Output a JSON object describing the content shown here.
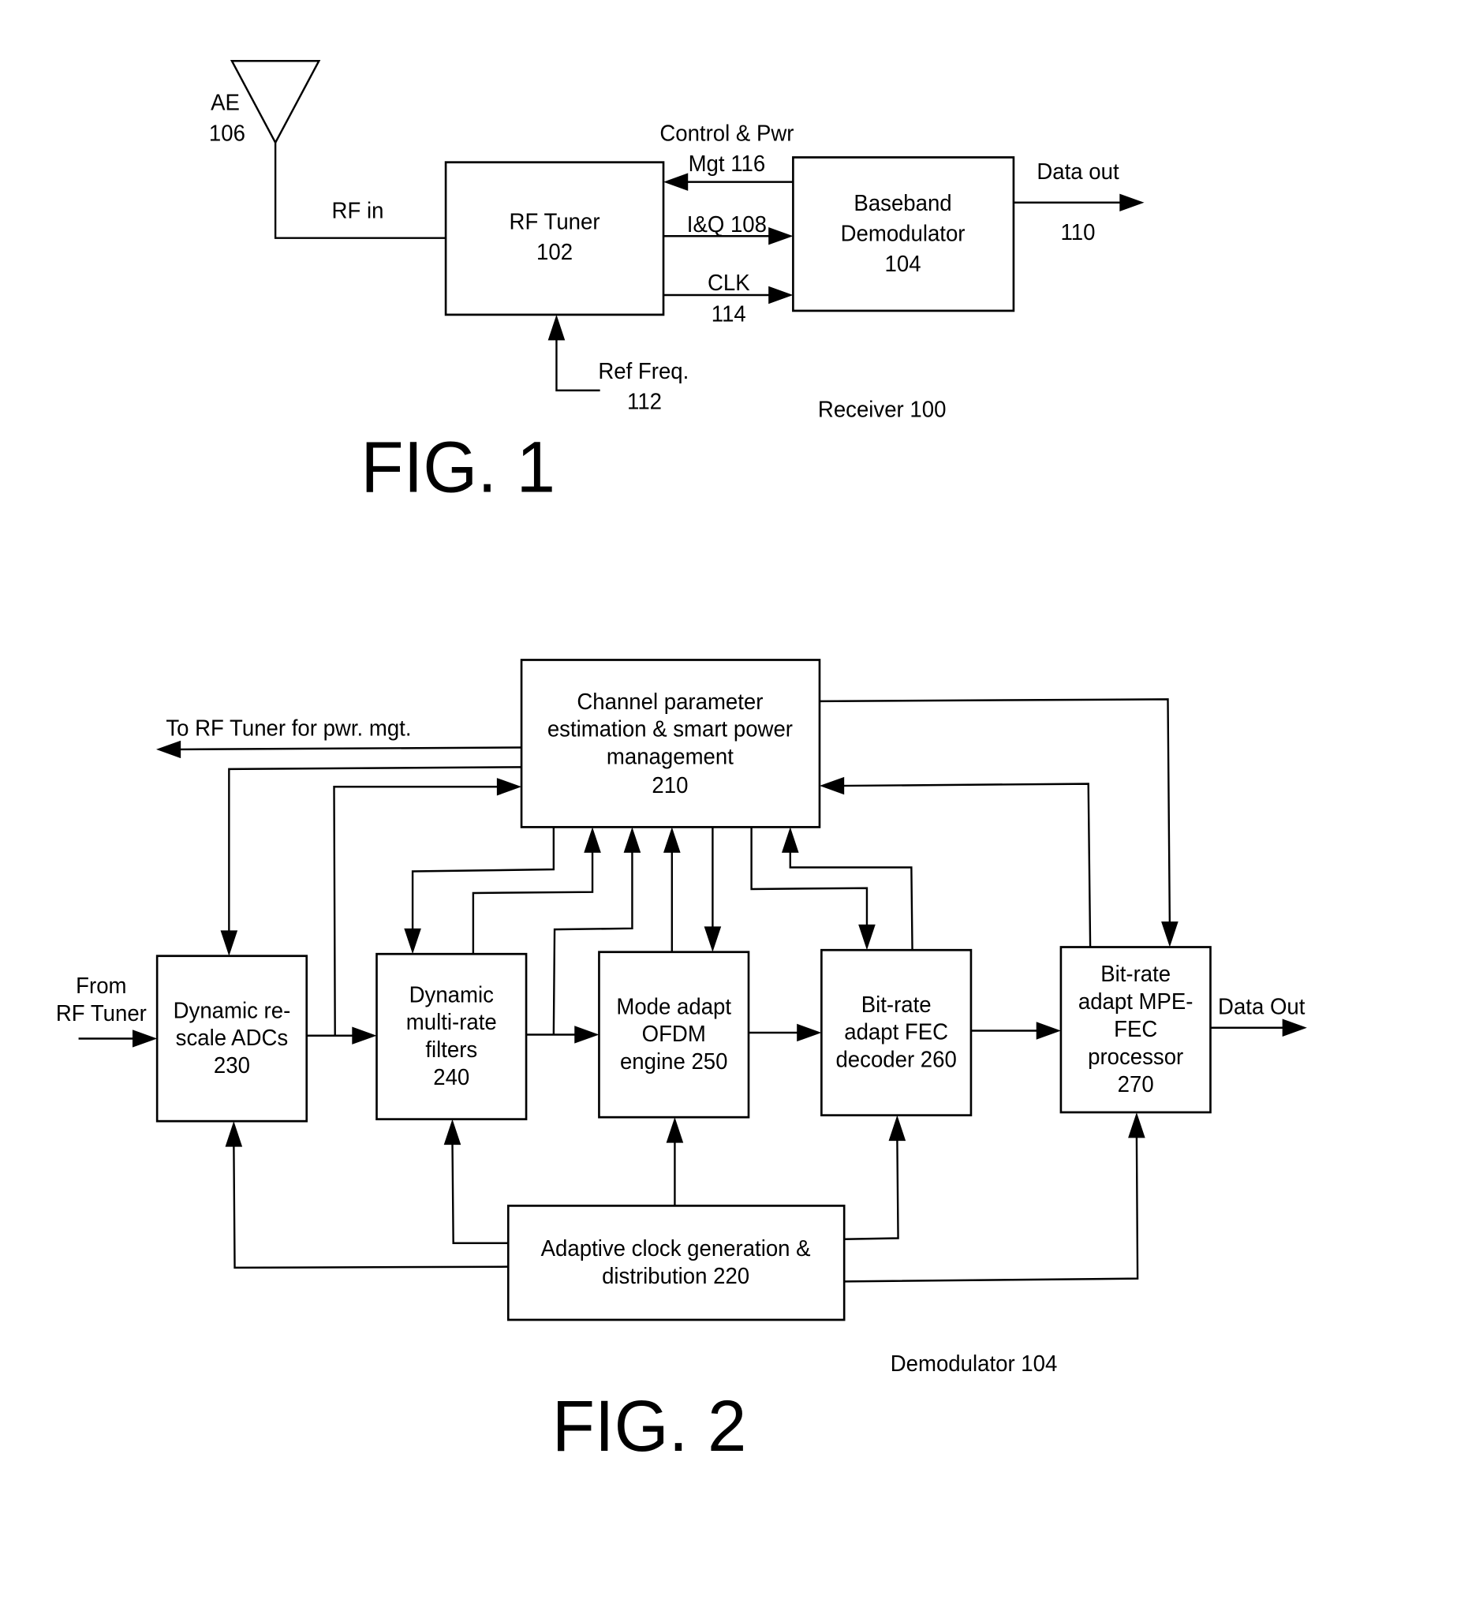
{
  "fig1": {
    "caption": "FIG. 1",
    "system_label": "Receiver 100",
    "antenna": {
      "lines": [
        "AE",
        "106"
      ]
    },
    "rf_in_label": "RF in",
    "rf_tuner": {
      "lines": [
        "RF Tuner",
        "102"
      ]
    },
    "baseband_demodulator": {
      "lines": [
        "Baseband",
        "Demodulator",
        "104"
      ]
    },
    "control_pwr_label": [
      "Control & Pwr",
      "Mgt 116"
    ],
    "iq_label": "I&Q 108",
    "clk_label": [
      "CLK",
      "114"
    ],
    "data_out_label": [
      "Data out",
      "110"
    ],
    "ref_freq_label": [
      "Ref Freq.",
      "112"
    ]
  },
  "fig2": {
    "caption": "FIG. 2",
    "system_label": "Demodulator 104",
    "to_rf_tuner_label": "To RF Tuner for pwr. mgt.",
    "from_rf_tuner_label": [
      "From",
      "RF Tuner"
    ],
    "data_out_label": "Data Out",
    "channel_param": {
      "lines": [
        "Channel parameter",
        "estimation & smart power",
        "management",
        "210"
      ]
    },
    "clock_gen": {
      "lines": [
        "Adaptive clock generation &",
        "distribution 220"
      ]
    },
    "adc": {
      "lines": [
        "Dynamic re-",
        "scale ADCs",
        "230"
      ]
    },
    "filters": {
      "lines": [
        "Dynamic",
        "multi-rate",
        "filters",
        "240"
      ]
    },
    "ofdm": {
      "lines": [
        "Mode adapt",
        "OFDM",
        "engine 250"
      ]
    },
    "fec": {
      "lines": [
        "Bit-rate",
        "adapt FEC",
        "decoder 260"
      ]
    },
    "mpe_fec": {
      "lines": [
        "Bit-rate",
        "adapt MPE-",
        "FEC",
        "processor",
        "270"
      ]
    }
  }
}
